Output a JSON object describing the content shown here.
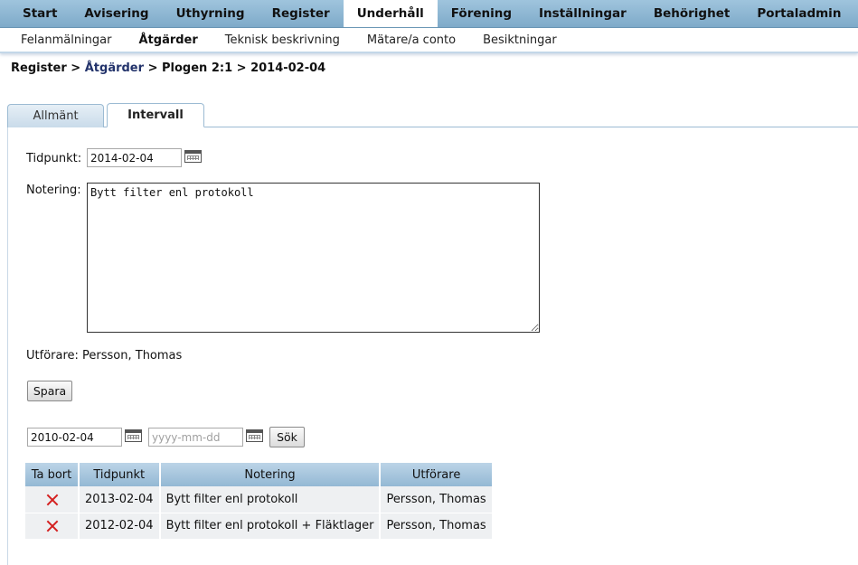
{
  "topnav": {
    "items": [
      {
        "label": "Start"
      },
      {
        "label": "Avisering"
      },
      {
        "label": "Uthyrning"
      },
      {
        "label": "Register"
      },
      {
        "label": "Underhåll",
        "active": true
      },
      {
        "label": "Förening"
      },
      {
        "label": "Inställningar"
      },
      {
        "label": "Behörighet"
      },
      {
        "label": "Portaladmin"
      }
    ]
  },
  "subnav": {
    "items": [
      {
        "label": "Felanmälningar"
      },
      {
        "label": "Åtgärder",
        "active": true
      },
      {
        "label": "Teknisk beskrivning"
      },
      {
        "label": "Mätare/a conto"
      },
      {
        "label": "Besiktningar"
      }
    ]
  },
  "breadcrumb": {
    "root": "Register",
    "sep1": " > ",
    "link": "Åtgärder",
    "sep2": " > ",
    "object": "Plogen 2:1",
    "sep3": " > ",
    "date": "2014-02-04"
  },
  "tabs": {
    "general": "Allmänt",
    "interval": "Intervall"
  },
  "form": {
    "time_label": "Tidpunkt:",
    "time_value": "2014-02-04",
    "note_label": "Notering:",
    "note_value": "Bytt filter enl protokoll",
    "performer_label": "Utförare:",
    "performer_value": "Persson, Thomas",
    "save_label": "Spara"
  },
  "filter": {
    "from_value": "2010-02-04",
    "to_placeholder": "yyyy-mm-dd",
    "search_label": "Sök"
  },
  "table": {
    "headers": {
      "delete": "Ta bort",
      "time": "Tidpunkt",
      "note": "Notering",
      "performer": "Utförare"
    },
    "rows": [
      {
        "time": "2013-02-04",
        "note": "Bytt filter enl protokoll",
        "performer": "Persson, Thomas"
      },
      {
        "time": "2012-02-04",
        "note": "Bytt filter enl protokoll + Fläktlager",
        "performer": "Persson, Thomas"
      }
    ]
  },
  "icons": {
    "calendar": "calendar-icon",
    "delete": "delete-x-icon"
  },
  "colors": {
    "nav_bg": "#8db6d3",
    "tab_border": "#9cbbd3",
    "delete_red": "#d42020",
    "link": "#23336b"
  }
}
